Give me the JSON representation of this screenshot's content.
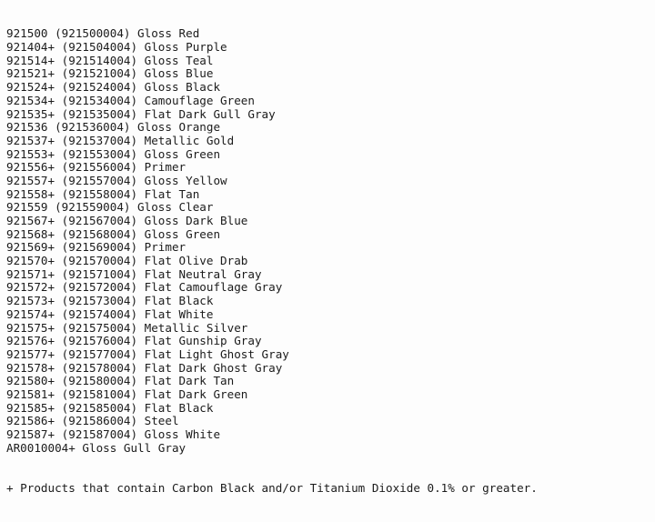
{
  "document": {
    "type": "plain-text-product-listing",
    "background_color": "#fdfdfd",
    "text_color": "#1b1b1b",
    "lines": [
      "921500 (921500004) Gloss Red",
      "921404+ (921504004) Gloss Purple",
      "921514+ (921514004) Gloss Teal",
      "921521+ (921521004) Gloss Blue",
      "921524+ (921524004) Gloss Black",
      "921534+ (921534004) Camouflage Green",
      "921535+ (921535004) Flat Dark Gull Gray",
      "921536 (921536004) Gloss Orange",
      "921537+ (921537004) Metallic Gold",
      "921553+ (921553004) Gloss Green",
      "921556+ (921556004) Primer",
      "921557+ (921557004) Gloss Yellow",
      "921558+ (921558004) Flat Tan",
      "921559 (921559004) Gloss Clear",
      "921567+ (921567004) Gloss Dark Blue",
      "921568+ (921568004) Gloss Green",
      "921569+ (921569004) Primer",
      "921570+ (921570004) Flat Olive Drab",
      "921571+ (921571004) Flat Neutral Gray",
      "921572+ (921572004) Flat Camouflage Gray",
      "921573+ (921573004) Flat Black",
      "921574+ (921574004) Flat White",
      "921575+ (921575004) Metallic Silver",
      "921576+ (921576004) Flat Gunship Gray",
      "921577+ (921577004) Flat Light Ghost Gray",
      "921578+ (921578004) Flat Dark Ghost Gray",
      "921580+ (921580004) Flat Dark Tan",
      "921581+ (921581004) Flat Dark Green",
      "921585+ (921585004) Flat Black",
      "921586+ (921586004) Steel",
      "921587+ (921587004) Gloss White",
      "AR0010004+ Gloss Gull Gray"
    ],
    "footnote": "+ Products that contain Carbon Black and/or Titanium Dioxide 0.1% or greater."
  }
}
